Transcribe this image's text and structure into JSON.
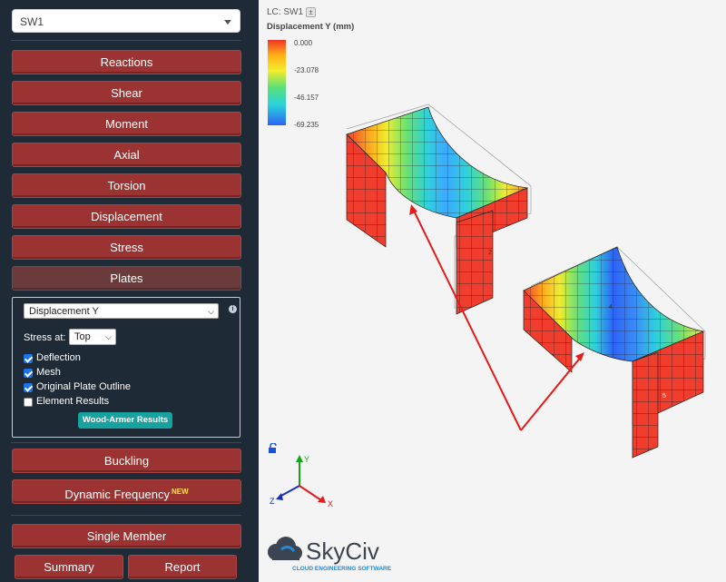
{
  "sidebar": {
    "load_case": "SW1",
    "buttons": {
      "reactions": "Reactions",
      "shear": "Shear",
      "moment": "Moment",
      "axial": "Axial",
      "torsion": "Torsion",
      "displacement": "Displacement",
      "stress": "Stress",
      "plates": "Plates",
      "buckling": "Buckling",
      "dynamic_frequency": "Dynamic Frequency",
      "dynamic_badge": "NEW",
      "single_member": "Single Member",
      "summary": "Summary",
      "report": "Report"
    },
    "plates_panel": {
      "result_type": "Displacement Y",
      "stress_at_label": "Stress at:",
      "stress_at_value": "Top",
      "options": [
        {
          "label": "Deflection",
          "checked": true
        },
        {
          "label": "Mesh",
          "checked": true
        },
        {
          "label": "Original Plate Outline",
          "checked": true
        },
        {
          "label": "Element Results",
          "checked": false
        }
      ],
      "wood_armer_label": "Wood-Armer Results"
    }
  },
  "viewport": {
    "lc_label": "LC: SW1",
    "lc_toggle": "±",
    "legend_title": "Displacement Y (mm)",
    "legend_ticks": [
      "0.000",
      "-23.078",
      "-46.157",
      "-69.235"
    ],
    "legend_colors": {
      "top": "#ee3423",
      "bottom": "#2e62f5"
    },
    "plate_ids": [
      "2",
      "4",
      "5"
    ],
    "axes": {
      "x": "X",
      "y": "Y",
      "z": "Z"
    },
    "logo_name": "SkyCiv",
    "logo_tagline": "CLOUD ENGINEERING SOFTWARE"
  }
}
